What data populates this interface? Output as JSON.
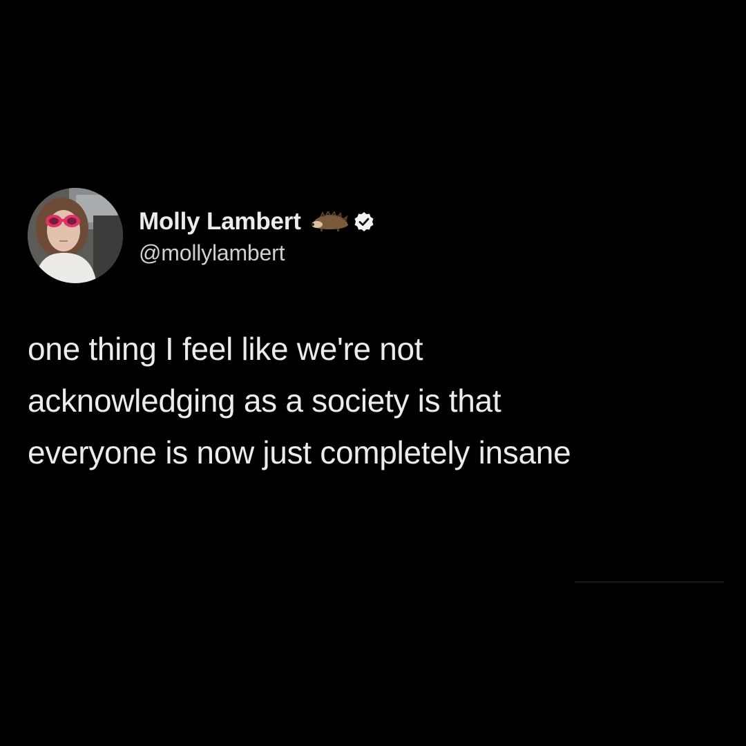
{
  "user": {
    "display_name": "Molly Lambert",
    "handle": "@mollylambert",
    "name_emoji_icon": "hedgehog-icon",
    "badge_icon": "verified-badge-icon"
  },
  "tweet": {
    "lines": [
      "one thing I feel like we're not",
      "acknowledging as a society is that",
      "everyone is now just completely insane"
    ]
  },
  "colors": {
    "background": "#000000",
    "text": "#ececec",
    "handle": "#d0d0d0",
    "sunglasses": "#e0336a"
  }
}
